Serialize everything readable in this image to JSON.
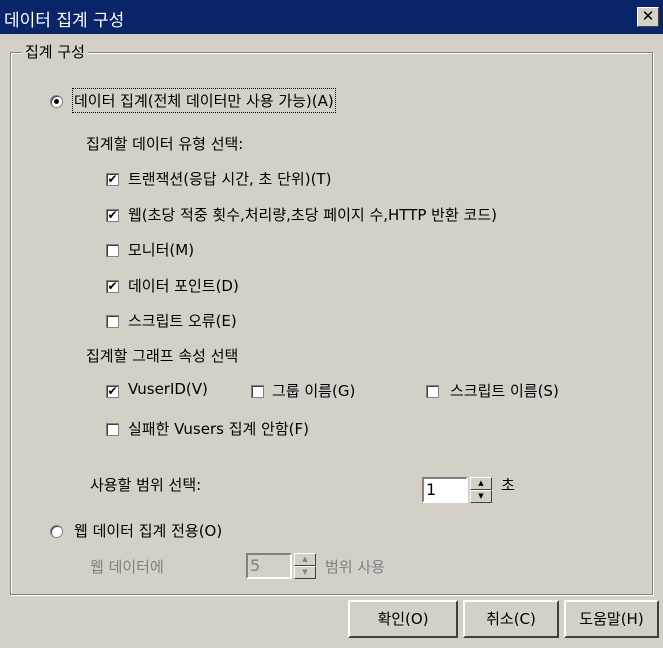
{
  "window": {
    "title": "데이터 집계 구성",
    "close_glyph": "✕"
  },
  "group": {
    "legend": "집계 구성"
  },
  "option_aggregate": {
    "label": "데이터 집계(전체 데이터만 사용 가능)(A)",
    "selected": true
  },
  "data_types": {
    "heading": "집계할 데이터 유형 선택:",
    "items": [
      {
        "label": "트랜잭션(응답 시간, 초 단위)(T)",
        "checked": true
      },
      {
        "label": "웹(초당 적중 횟수,처리량,초당 페이지 수,HTTP 반환 코드)",
        "checked": true
      },
      {
        "label": "모니터(M)",
        "checked": false
      },
      {
        "label": "데이터 포인트(D)",
        "checked": true
      },
      {
        "label": "스크립트 오류(E)",
        "checked": false
      }
    ]
  },
  "graph_props": {
    "heading": "집계할 그래프 속성 선택",
    "vuserid": {
      "label": "VuserID(V)",
      "checked": true
    },
    "group_name": {
      "label": "그룹 이름(G)",
      "checked": false
    },
    "script_name": {
      "label": "스크립트 이름(S)",
      "checked": false
    },
    "failed_vusers": {
      "label": "실패한 Vusers 집계 안함(F)",
      "checked": false
    }
  },
  "granularity": {
    "label": "사용할 범위 선택:",
    "value": "1",
    "unit": "초"
  },
  "option_web": {
    "label": "웹 데이터 집계 전용(O)",
    "selected": false
  },
  "web_granularity": {
    "prefix": "웹 데이터에",
    "value": "5",
    "suffix": "범위 사용"
  },
  "buttons": {
    "ok": "확인(O)",
    "cancel": "취소(C)",
    "help": "도움말(H)"
  },
  "check_glyph": "✔",
  "spin": {
    "up": "▲",
    "down": "▼"
  }
}
